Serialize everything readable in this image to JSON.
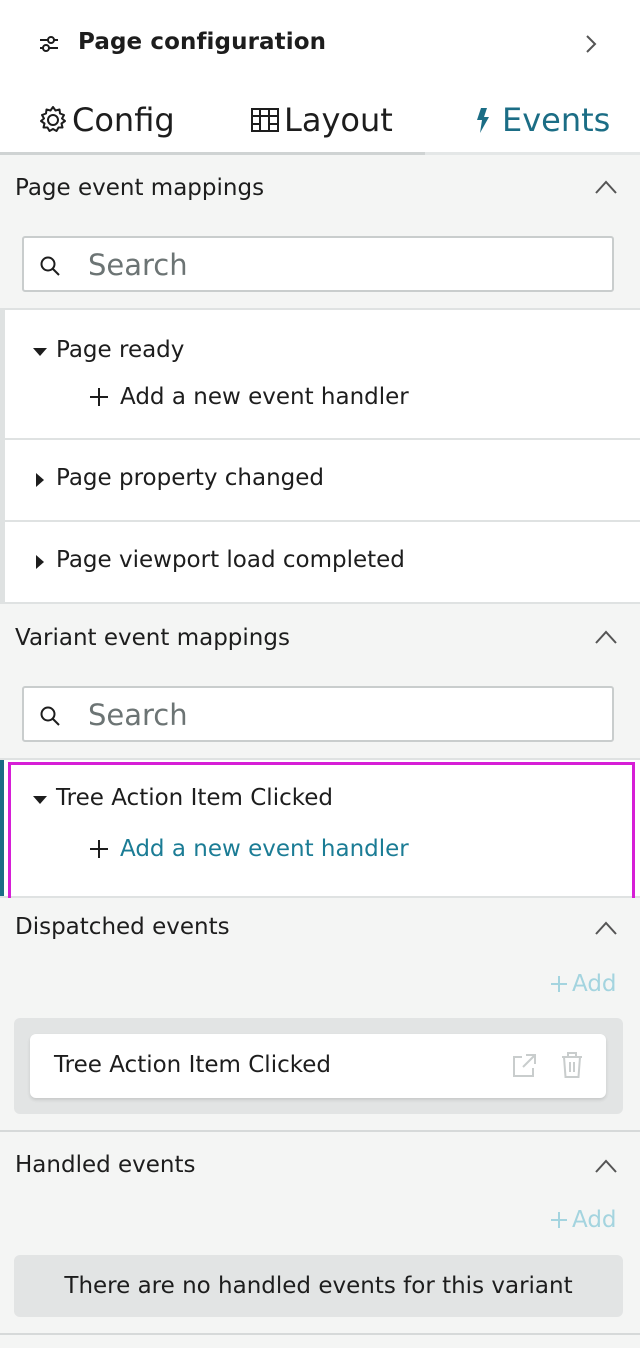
{
  "header": {
    "title": "Page configuration",
    "icons": {
      "config": "sliders-icon",
      "expand": "chevron-right-icon"
    }
  },
  "tabs": [
    {
      "label": "Config",
      "icon": "gear-icon",
      "active": false
    },
    {
      "label": "Layout",
      "icon": "layout-columns-icon",
      "active": false
    },
    {
      "label": "Events",
      "icon": "lightning-icon",
      "active": true
    }
  ],
  "colors": {
    "accent": "#1b6d85",
    "link": "#1b7c95",
    "highlight": "#d61ed6",
    "add_disabled": "#a4d4df"
  },
  "page_events": {
    "title": "Page event mappings",
    "search_placeholder": "Search",
    "items": [
      {
        "label": "Page ready",
        "expanded": true,
        "add_handler": "Add a new event handler"
      },
      {
        "label": "Page property changed",
        "expanded": false
      },
      {
        "label": "Page viewport load completed",
        "expanded": false
      }
    ]
  },
  "variant_events": {
    "title": "Variant event mappings",
    "search_placeholder": "Search",
    "items": [
      {
        "label": "Tree Action Item Clicked",
        "expanded": true,
        "add_handler": "Add a new event handler"
      }
    ]
  },
  "dispatched_events": {
    "title": "Dispatched events",
    "add_label": "Add",
    "items": [
      {
        "label": "Tree Action Item Clicked"
      }
    ]
  },
  "handled_events": {
    "title": "Handled events",
    "add_label": "Add",
    "empty_message": "There are no handled events for this variant"
  }
}
